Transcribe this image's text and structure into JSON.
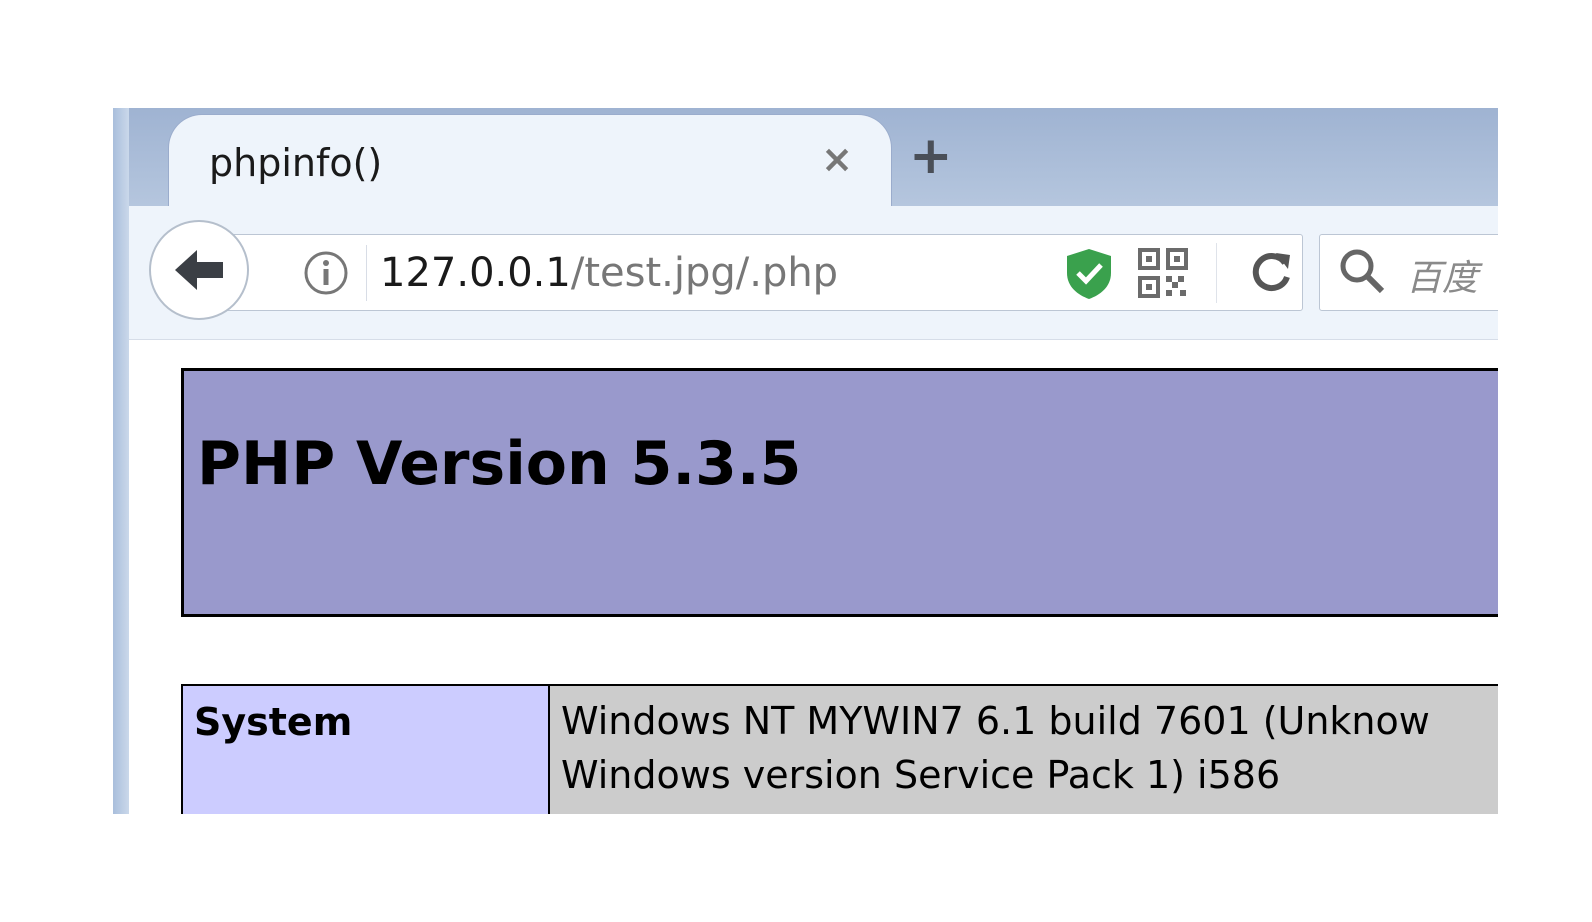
{
  "tab": {
    "title": "phpinfo()",
    "close_glyph": "×",
    "new_tab_glyph": "+"
  },
  "navbar": {
    "url_host": "127.0.0.1",
    "url_path": "/test.jpg/.php",
    "search_placeholder": "百度"
  },
  "icons": {
    "back": "back-arrow-icon",
    "info": "info-icon",
    "security": "shield-check-icon",
    "qr": "qr-code-icon",
    "reload": "reload-icon",
    "search": "search-icon"
  },
  "content": {
    "title": "PHP Version 5.3.5",
    "rows": [
      {
        "label": "System",
        "value": "Windows NT MYWIN7 6.1 build 7601 (Unknow Windows version Service Pack 1) i586"
      }
    ]
  },
  "colors": {
    "header_bg": "#9999cc",
    "label_bg": "#ccccff",
    "value_bg": "#cccccc",
    "shield": "#3aa14d"
  }
}
